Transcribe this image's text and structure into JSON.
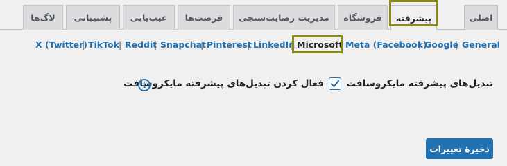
{
  "tabs": [
    {
      "label": "اصلی",
      "active": false
    },
    {
      "label": "پیشرفته",
      "active": true
    },
    {
      "label": "فروشگاه",
      "active": false
    },
    {
      "label": "مدیریت رضایت‌سنجی",
      "active": false
    },
    {
      "label": "فرصت‌ها",
      "active": false
    },
    {
      "label": "عیب‌یابی",
      "active": false
    },
    {
      "label": "پشتیبانی",
      "active": false
    },
    {
      "label": "لاگ‌ها",
      "active": false
    }
  ],
  "subnav": {
    "links": [
      {
        "label": "General",
        "current": false
      },
      {
        "label": "Google",
        "current": false
      },
      {
        "label": "Meta (Facebook)",
        "current": false
      },
      {
        "label": "Microsoft",
        "current": true
      },
      {
        "label": "LinkedIn",
        "current": false
      },
      {
        "label": "Pinterest",
        "current": false
      },
      {
        "label": "Snapchat",
        "current": false
      },
      {
        "label": "Reddit",
        "current": false
      },
      {
        "label": "TikTok",
        "current": false
      },
      {
        "label": "X (Twitter)",
        "current": false
      }
    ],
    "separator": "|"
  },
  "setting": {
    "label": "تبدیل‌های پیشرفته مایکروسافت",
    "checkbox_label": "فعال کردن تبدیل‌های پیشرفته مایکروسافت",
    "checked": true,
    "info_icon": "info-icon",
    "info_glyph": "i"
  },
  "save_button": {
    "label": "ذخیرهٔ تغییرات"
  },
  "colors": {
    "accent": "#2271b1",
    "highlight": "#8a8a16",
    "background": "#f0f0f1",
    "tab_inactive": "#dcdcde"
  }
}
